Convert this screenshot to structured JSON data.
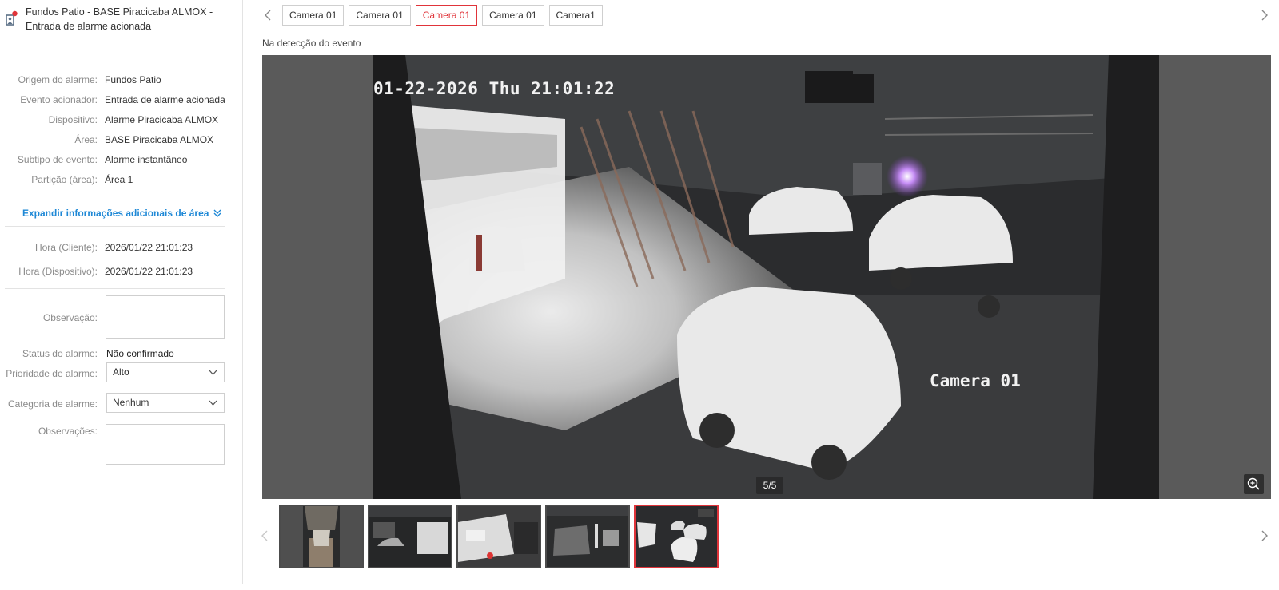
{
  "alarm": {
    "title": "Fundos Patio - BASE Piracicaba ALMOX - Entrada de alarme acionada",
    "details": [
      {
        "label": "Origem do alarme:",
        "value": "Fundos Patio"
      },
      {
        "label": "Evento acionador:",
        "value": "Entrada de alarme acionada"
      },
      {
        "label": "Dispositivo:",
        "value": "Alarme Piracicaba ALMOX"
      },
      {
        "label": "Área:",
        "value": "BASE Piracicaba ALMOX"
      },
      {
        "label": "Subtipo de evento:",
        "value": "Alarme instantâneo"
      },
      {
        "label": "Partição (área):",
        "value": "Área 1"
      }
    ],
    "expand_label": "Expandir informações adicionais de área",
    "times": [
      {
        "label": "Hora (Cliente):",
        "value": "2026/01/22 21:01:23"
      },
      {
        "label": "Hora (Dispositivo):",
        "value": "2026/01/22 21:01:23"
      }
    ],
    "observacao_label": "Observação:",
    "status_label": "Status do alarme:",
    "status_value": "Não confirmado",
    "priority_label": "Prioridade de alarme:",
    "priority_value": "Alto",
    "category_label": "Categoria de alarme:",
    "category_value": "Nenhum",
    "observacoes_label": "Observações:"
  },
  "viewer": {
    "tabs": [
      "Camera 01",
      "Camera 01",
      "Camera 01",
      "Camera 01",
      "Camera1"
    ],
    "active_tab": 2,
    "caption": "Na detecção do evento",
    "osd_timestamp": "01-22-2026 Thu 21:01:22",
    "osd_camera": "Camera 01",
    "counter": "5/5",
    "thumbnail_count": 5,
    "active_thumbnail": 4
  },
  "colors": {
    "accent": "#e0343a",
    "link": "#1e88d6",
    "notification_dot": "#e0343a"
  },
  "icons": {
    "header": "alarm-person-icon",
    "expand": "double-chevron-down-icon",
    "prev": "chevron-left-icon",
    "next": "chevron-right-icon",
    "zoom": "zoom-in-icon",
    "select": "chevron-down-icon"
  }
}
